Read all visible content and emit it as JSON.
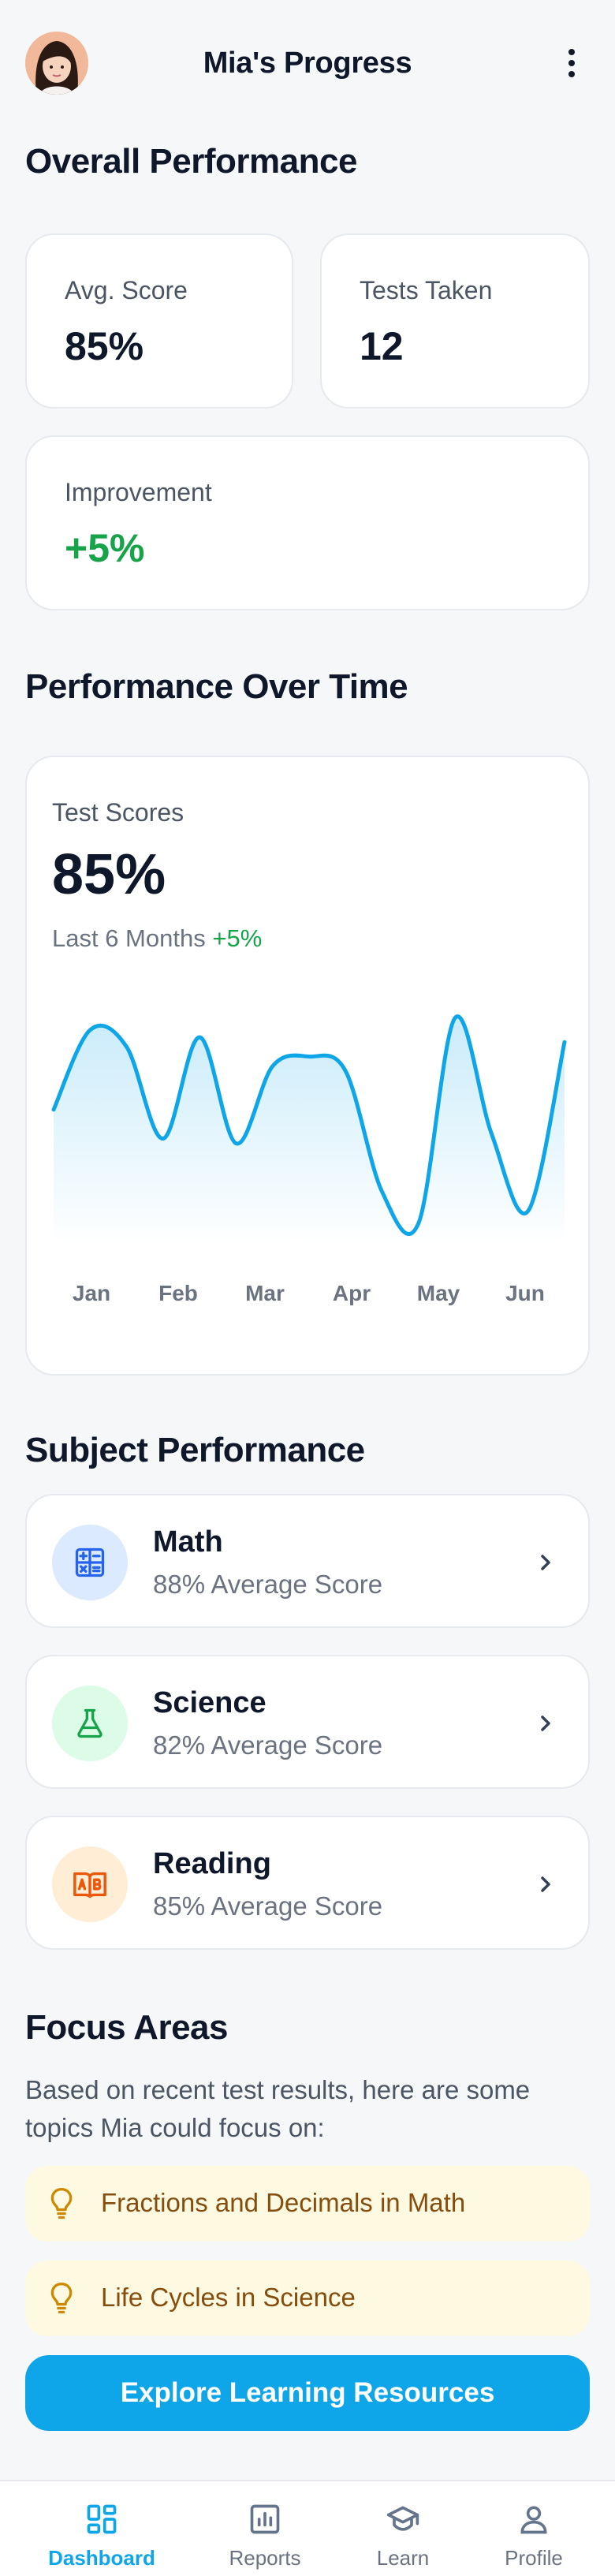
{
  "header": {
    "title": "Mia's Progress",
    "avatar_icon": "girl-avatar",
    "menu_icon": "more-vertical-icon"
  },
  "overall": {
    "title": "Overall Performance",
    "stats": [
      {
        "label": "Avg. Score",
        "value": "85%"
      },
      {
        "label": "Tests Taken",
        "value": "12"
      },
      {
        "label": "Improvement",
        "value": "+5%",
        "color": "#16a34a"
      }
    ]
  },
  "performance": {
    "title": "Performance Over Time",
    "card_label": "Test Scores",
    "big_value": "85%",
    "period": "Last 6 Months",
    "delta": "+5%"
  },
  "chart_data": {
    "type": "area",
    "title": "Test Scores",
    "categories": [
      "Jan",
      "Feb",
      "Mar",
      "Apr",
      "May",
      "Jun"
    ],
    "series": [
      {
        "values": [
          52,
          85,
          78,
          40,
          82,
          38,
          70,
          74,
          68,
          18,
          5,
          90,
          42,
          10,
          80
        ]
      }
    ],
    "ylim": [
      0,
      100
    ],
    "color": "#0ea5e9",
    "grid": false
  },
  "subjects": {
    "title": "Subject Performance",
    "items": [
      {
        "name": "Math",
        "score": "88% Average Score",
        "icon": "calculator-icon",
        "bg": "#dbeafe",
        "fg": "#2563eb"
      },
      {
        "name": "Science",
        "score": "82% Average Score",
        "icon": "flask-icon",
        "bg": "#dcfce7",
        "fg": "#16a34a"
      },
      {
        "name": "Reading",
        "score": "85% Average Score",
        "icon": "book-icon",
        "bg": "#ffedd5",
        "fg": "#ea580c"
      }
    ]
  },
  "focus": {
    "title": "Focus Areas",
    "description": "Based on recent test results, here are some topics Mia could focus on:",
    "items": [
      {
        "text": "Fractions and Decimals in Math",
        "icon": "lightbulb-icon"
      },
      {
        "text": "Life Cycles in Science",
        "icon": "lightbulb-icon"
      }
    ],
    "cta": "Explore Learning Resources"
  },
  "nav": {
    "items": [
      {
        "label": "Dashboard",
        "icon": "dashboard-icon",
        "active": true
      },
      {
        "label": "Reports",
        "icon": "bar-chart-icon",
        "active": false
      },
      {
        "label": "Learn",
        "icon": "graduation-cap-icon",
        "active": false
      },
      {
        "label": "Profile",
        "icon": "user-icon",
        "active": false
      }
    ]
  }
}
